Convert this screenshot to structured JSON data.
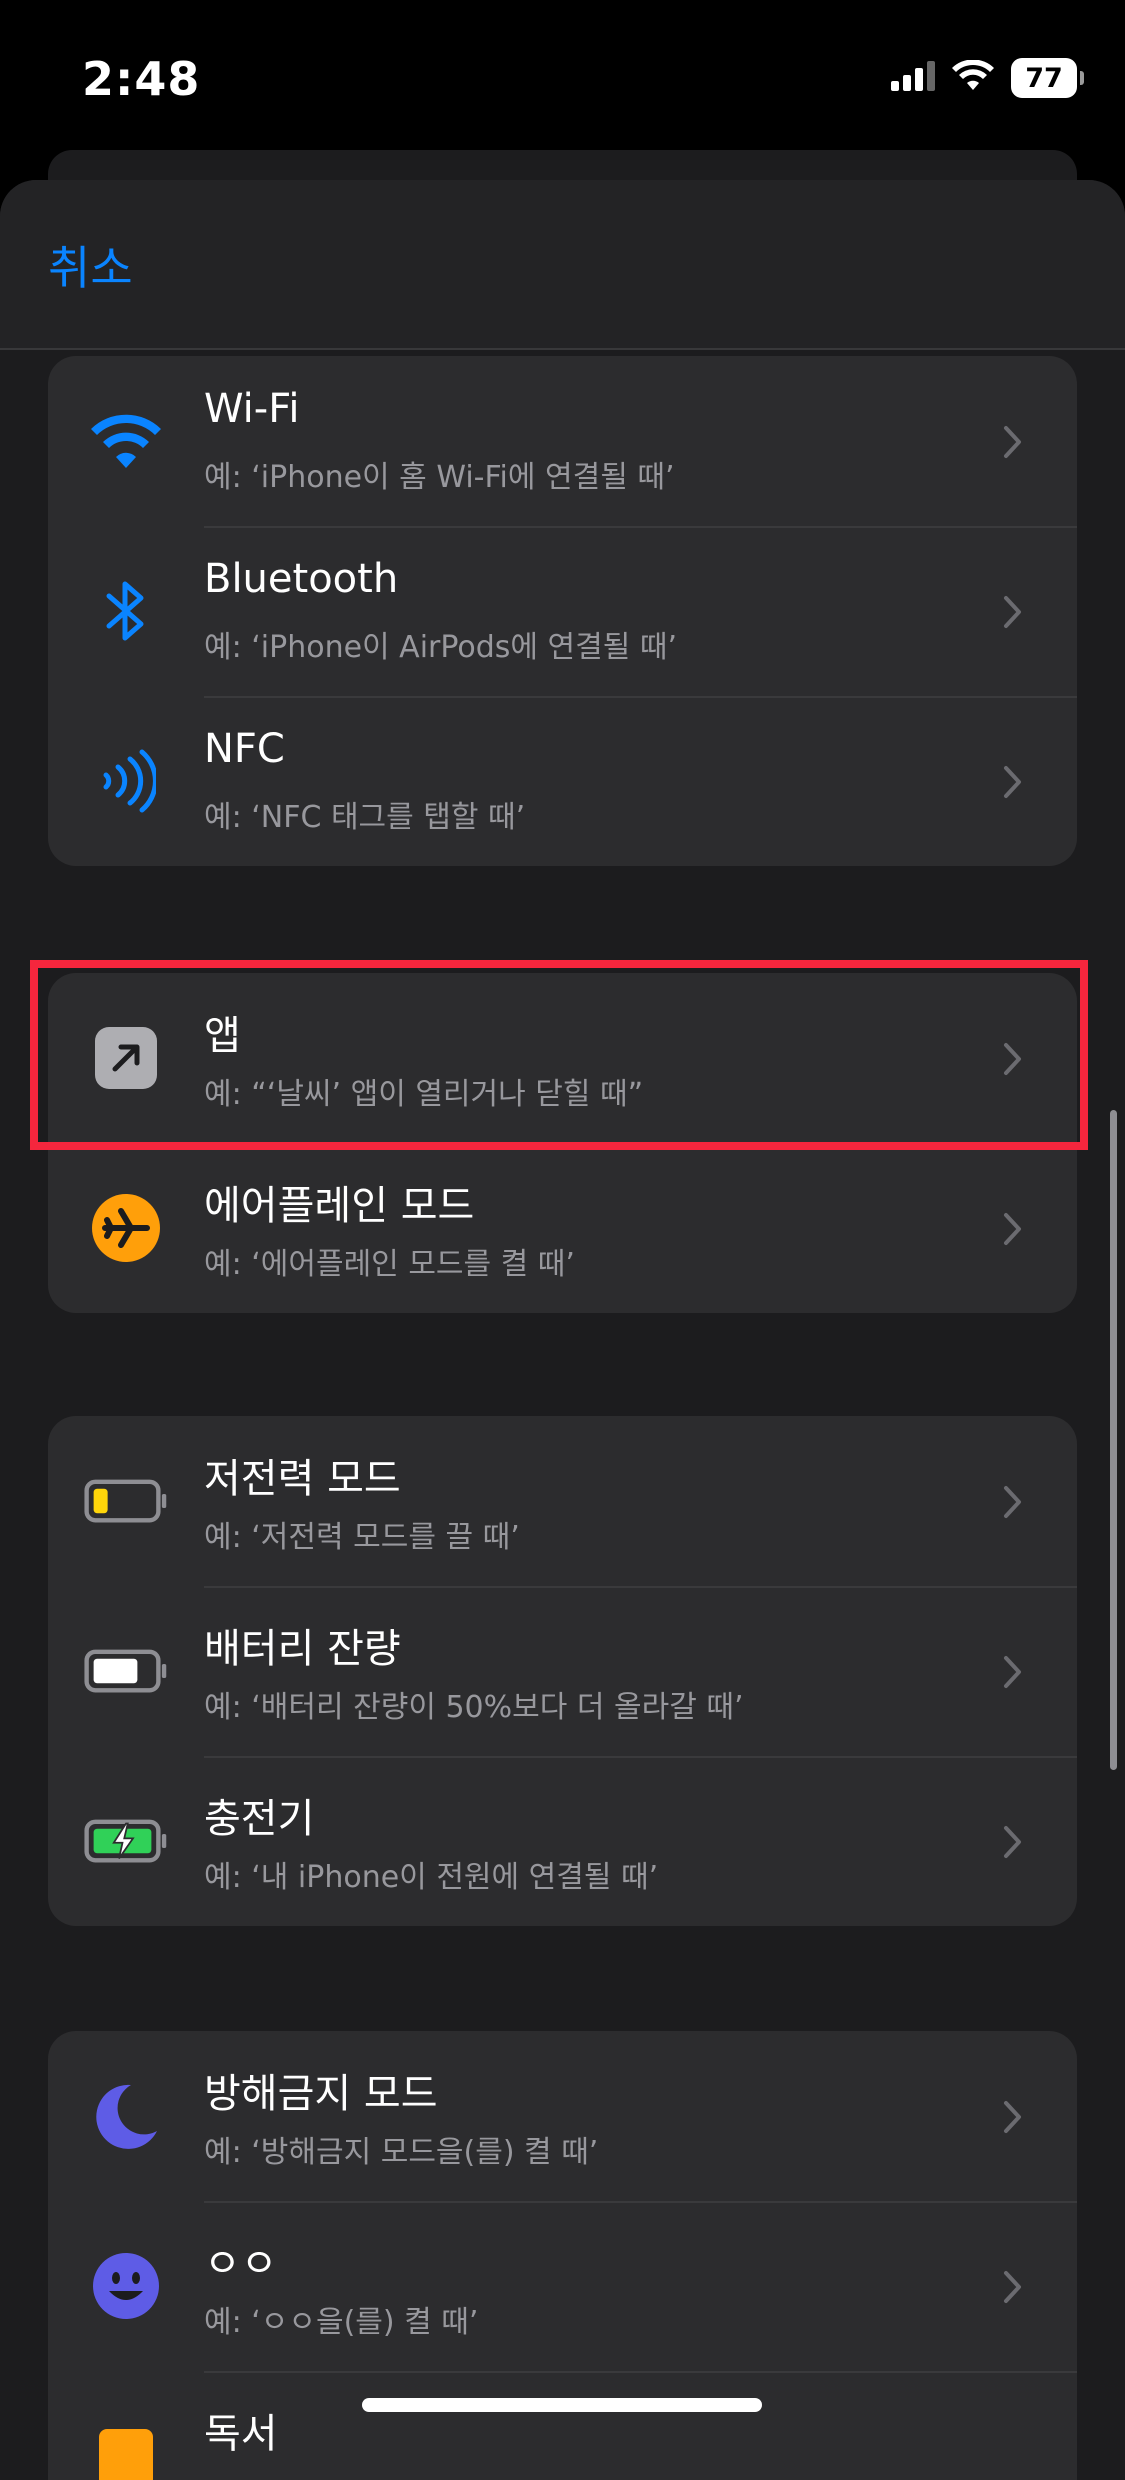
{
  "status_bar": {
    "time": "2:48",
    "battery": "77"
  },
  "header": {
    "cancel_label": "취소"
  },
  "groups": [
    {
      "rows": [
        {
          "title": "Wi-Fi",
          "subtitle": "예: ‘iPhone이 홈 Wi-Fi에 연결될 때’",
          "icon": "wifi-icon"
        },
        {
          "title": "Bluetooth",
          "subtitle": "예: ‘iPhone이 AirPods에 연결될 때’",
          "icon": "bluetooth-icon"
        },
        {
          "title": "NFC",
          "subtitle": "예: ‘NFC 태그를 탭할 때’",
          "icon": "nfc-icon"
        }
      ]
    },
    {
      "rows": [
        {
          "title": "앱",
          "subtitle": "예: “‘날씨’ 앱이 열리거나 닫힐 때”",
          "icon": "app-arrow-icon"
        },
        {
          "title": "에어플레인 모드",
          "subtitle": "예: ‘에어플레인 모드를 켤 때’",
          "icon": "airplane-icon"
        }
      ]
    },
    {
      "rows": [
        {
          "title": "저전력 모드",
          "subtitle": "예: ‘저전력 모드를 끌 때’",
          "icon": "low-power-battery-icon"
        },
        {
          "title": "배터리 잔량",
          "subtitle": "예: ‘배터리 잔량이 50%보다 더 올라갈 때’",
          "icon": "battery-level-icon"
        },
        {
          "title": "충전기",
          "subtitle": "예: ‘내 iPhone이 전원에 연결될 때’",
          "icon": "charger-icon"
        }
      ]
    },
    {
      "rows": [
        {
          "title": "방해금지 모드",
          "subtitle": "예: ‘방해금지 모드을(를) 켤 때’",
          "icon": "moon-icon"
        },
        {
          "title": "ㅇㅇ",
          "subtitle": "예: ‘ㅇㅇ을(를) 켤 때’",
          "icon": "smiley-icon"
        },
        {
          "title": "독서",
          "subtitle": "",
          "icon": "book-icon"
        }
      ]
    }
  ],
  "colors": {
    "accent": "#0a84ff",
    "highlight": "#f5263d",
    "airplane": "#ff9f0a",
    "focus": "#5e5ce6",
    "charge": "#30d158",
    "low_power": "#ffd60a"
  }
}
